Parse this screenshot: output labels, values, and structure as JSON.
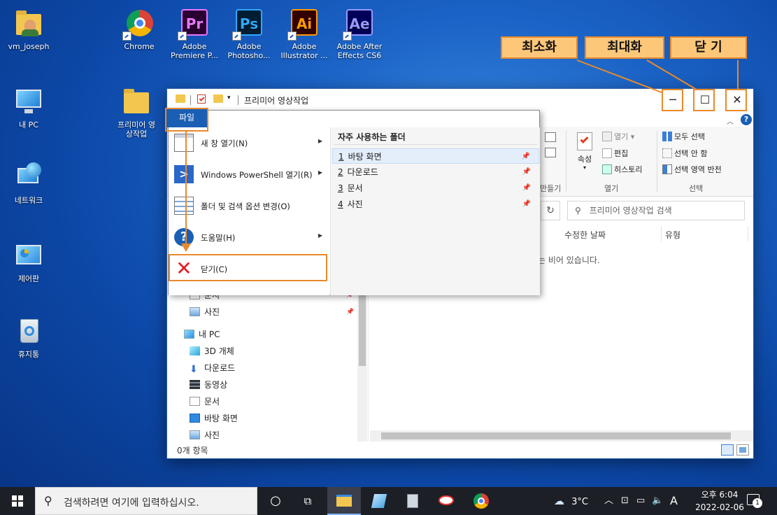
{
  "desktop": {
    "icons": [
      {
        "label": "vm_joseph"
      },
      {
        "label": "Chrome"
      },
      {
        "label": "Adobe Premiere P...",
        "mark": "Pr"
      },
      {
        "label": "Adobe Photosho...",
        "mark": "Ps"
      },
      {
        "label": "Adobe Illustrator ...",
        "mark": "Ai"
      },
      {
        "label": "Adobe After Effects CS6",
        "mark": "Ae"
      },
      {
        "label": "내 PC"
      },
      {
        "label": "프리미어 영상작업"
      },
      {
        "label": "네트워크"
      },
      {
        "label": "제어판"
      },
      {
        "label": "휴지통"
      }
    ]
  },
  "callouts": {
    "minimize": "최소화",
    "maximize": "최대화",
    "close": "닫 기"
  },
  "window": {
    "title": "프리미어 영상작업",
    "controls": {
      "minimize": "─",
      "maximize": "☐",
      "close": "✕"
    }
  },
  "file_menu": {
    "tab": "파일",
    "items": [
      {
        "label": "새 창 열기(N)"
      },
      {
        "label": "Windows PowerShell 열기(R)"
      },
      {
        "label": "폴더 및 검색 옵션 변경(O)"
      },
      {
        "label": "도움말(H)"
      },
      {
        "label": "닫기(C)"
      }
    ],
    "recent_header": "자주 사용하는 폴더",
    "recent": [
      {
        "num": "1",
        "label": "바탕 화면"
      },
      {
        "num": "2",
        "label": "다운로드"
      },
      {
        "num": "3",
        "label": "문서"
      },
      {
        "num": "4",
        "label": "사진"
      }
    ]
  },
  "ribbon": {
    "share_group_label": "만들기",
    "properties": "속성",
    "open": "열기",
    "edit": "편집",
    "history": "히스토리",
    "open_group": "열기",
    "select_all": "모두 선택",
    "select_none": "선택 안 함",
    "invert": "선택 영역 반전",
    "select_group": "선택"
  },
  "address": {
    "search_placeholder": "프리미어 영상작업 검색"
  },
  "columns": {
    "modified": "수정한 날짜",
    "type": "유형"
  },
  "empty_text": "는 비어 있습니다.",
  "nav": {
    "quick": [
      {
        "label": "문서"
      },
      {
        "label": "사진"
      }
    ],
    "this_pc": "내 PC",
    "pc_items": [
      {
        "label": "3D 개체"
      },
      {
        "label": "다운로드"
      },
      {
        "label": "동영상"
      },
      {
        "label": "문서"
      },
      {
        "label": "바탕 화면"
      },
      {
        "label": "사진"
      }
    ]
  },
  "status_bar": "0개 항목",
  "taskbar": {
    "search_placeholder": "검색하려면 여기에 입력하십시오.",
    "weather": "3°C",
    "ime": "A",
    "time": "오후 6:04",
    "date": "2022-02-06",
    "notifications": "1"
  },
  "colors": {
    "accent": "#1a5fb4",
    "callout_fill": "#fdc77a",
    "callout_border": "#e8892a",
    "close_x": "#e02020"
  }
}
